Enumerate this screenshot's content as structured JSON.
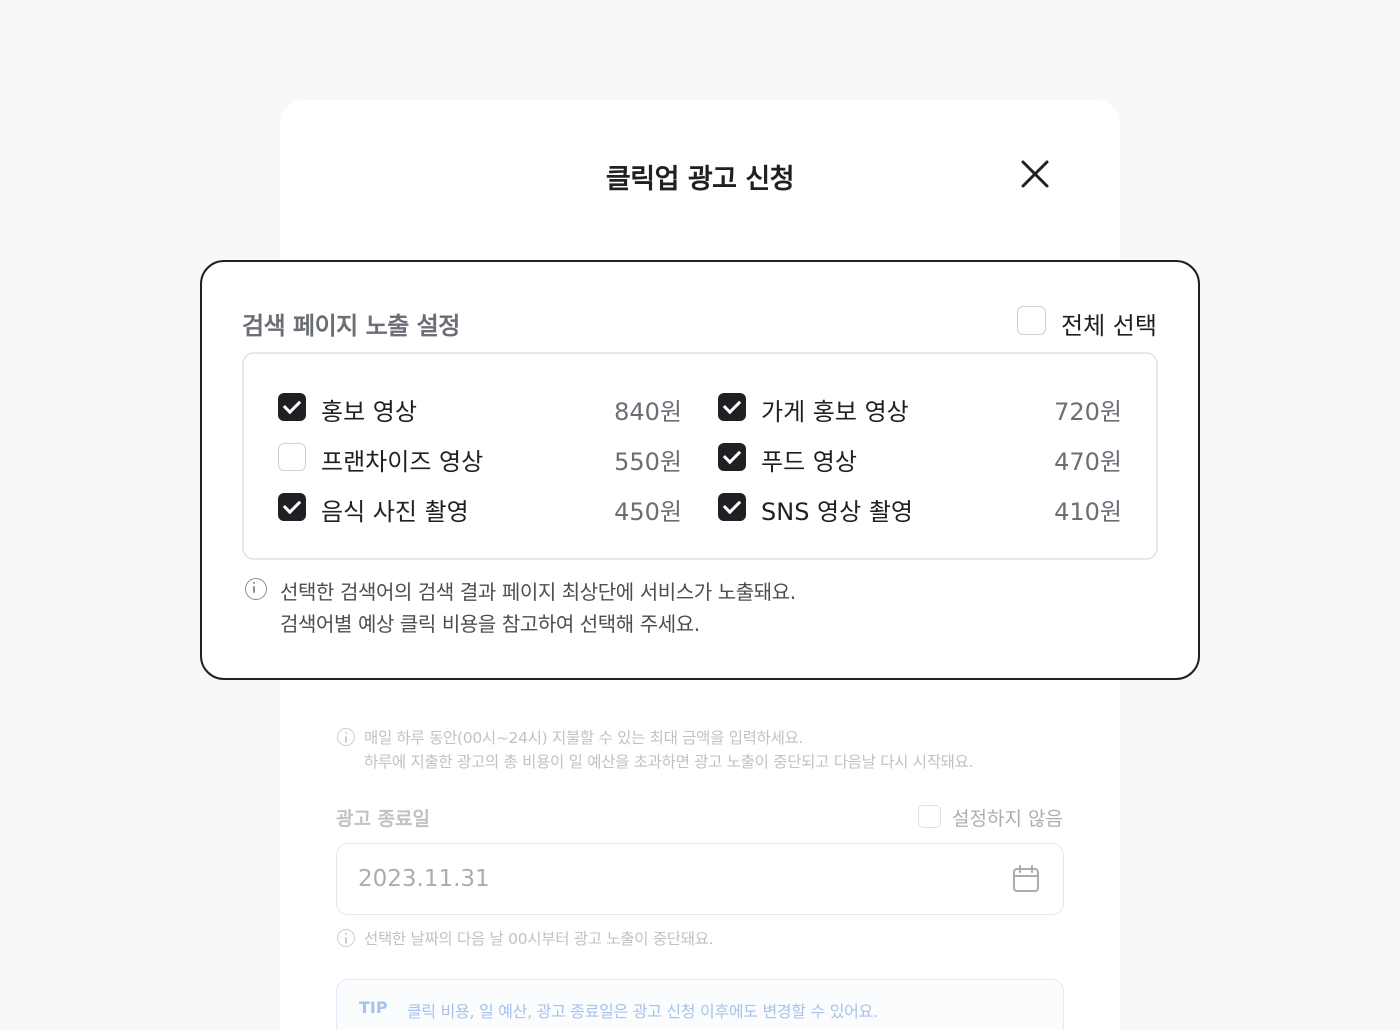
{
  "modal": {
    "title": "클릭업 광고 신청"
  },
  "budget": {
    "note_line1": "매일 하루 동안(00시~24시) 지불할 수 있는 최대 금액을 입력하세요.",
    "note_line2": "하루에 지출한 광고의 총 비용이 일 예산을 초과하면 광고 노출이 중단되고 다음날 다시 시작돼요."
  },
  "end_date": {
    "label": "광고 종료일",
    "no_setting_label": "설정하지 않음",
    "no_setting_checked": false,
    "value": "2023.11.31",
    "note": "선택한 날짜의 다음 날 00시부터 광고 노출이 중단돼요."
  },
  "tip": {
    "tag": "TIP",
    "text": "클릭 비용, 일 예산, 광고 종료일은 광고 신청 이후에도 변경할 수 있어요."
  },
  "search_exposure": {
    "title": "검색 페이지 노출 설정",
    "select_all_label": "전체 선택",
    "select_all_checked": false,
    "options": [
      {
        "label": "홍보 영상",
        "price": "840원",
        "checked": true
      },
      {
        "label": "가게 홍보 영상",
        "price": "720원",
        "checked": true
      },
      {
        "label": "프랜차이즈 영상",
        "price": "550원",
        "checked": false
      },
      {
        "label": "푸드 영상",
        "price": "470원",
        "checked": true
      },
      {
        "label": "음식 사진 촬영",
        "price": "450원",
        "checked": true
      },
      {
        "label": "SNS 영상 촬영",
        "price": "410원",
        "checked": true
      }
    ],
    "note_line1": "선택한 검색어의 검색 결과 페이지 최상단에 서비스가 노출돼요.",
    "note_line2": "검색어별 예상 클릭 비용을 참고하여 선택해 주세요."
  },
  "colors": {
    "text_primary": "#1f2023",
    "text_secondary": "#6b6e75",
    "tip_accent": "#2f6fcf",
    "checkbox_checked": "#1f2023"
  }
}
